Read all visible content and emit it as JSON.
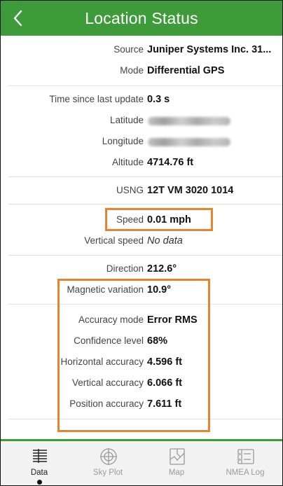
{
  "header": {
    "title": "Location Status",
    "back_icon": "chevron-left-icon",
    "color": "#3d9b3a"
  },
  "rows": {
    "source": {
      "label": "Source",
      "value": "Juniper Systems Inc. 31..."
    },
    "mode": {
      "label": "Mode",
      "value": "Differential GPS"
    },
    "time_since_update": {
      "label": "Time since last update",
      "value": "0.3 s"
    },
    "latitude": {
      "label": "Latitude",
      "value": ""
    },
    "longitude": {
      "label": "Longitude",
      "value": ""
    },
    "altitude": {
      "label": "Altitude",
      "value": "4714.76 ft"
    },
    "usng": {
      "label": "USNG",
      "value": "12T VM 3020 1014"
    },
    "speed": {
      "label": "Speed",
      "value": "0.01 mph"
    },
    "vertical_speed": {
      "label": "Vertical speed",
      "value": "No data"
    },
    "direction": {
      "label": "Direction",
      "value": "212.6°"
    },
    "magnetic_variation": {
      "label": "Magnetic variation",
      "value": "10.9°"
    },
    "accuracy_mode": {
      "label": "Accuracy mode",
      "value": "Error RMS"
    },
    "confidence_level": {
      "label": "Confidence level",
      "value": "68%"
    },
    "horizontal_accuracy": {
      "label": "Horizontal accuracy",
      "value": "4.596 ft"
    },
    "vertical_accuracy": {
      "label": "Vertical accuracy",
      "value": "6.066 ft"
    },
    "position_accuracy": {
      "label": "Position accuracy",
      "value": "7.611 ft"
    }
  },
  "highlight_color": "#e8832f",
  "tabs": [
    {
      "label": "Data",
      "icon": "data-list-icon",
      "active": true
    },
    {
      "label": "Sky Plot",
      "icon": "sky-plot-icon",
      "active": false
    },
    {
      "label": "Map",
      "icon": "map-icon",
      "active": false
    },
    {
      "label": "NMEA Log",
      "icon": "nmea-log-icon",
      "active": false
    }
  ]
}
